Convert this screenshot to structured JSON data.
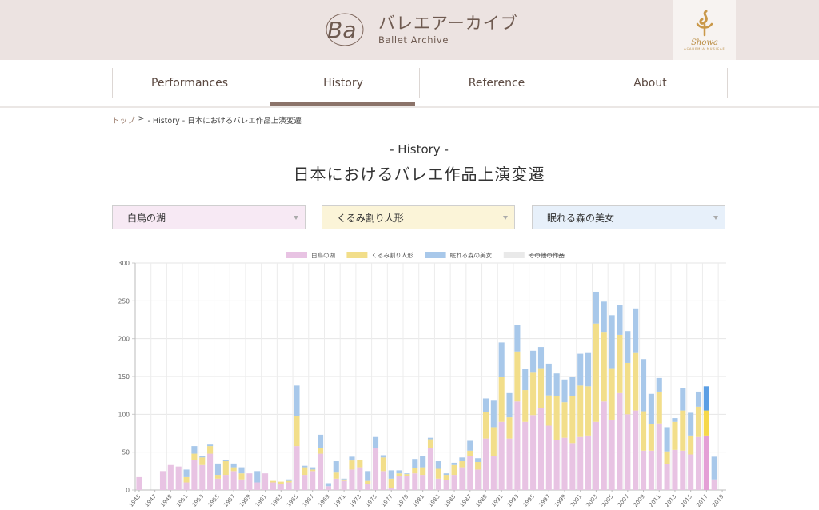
{
  "header": {
    "logo_monogram": "Ba",
    "logo_title_jp": "バレエアーカイブ",
    "logo_title_en": "Ballet Archive",
    "sponsor_name": "Showa",
    "sponsor_sub": "ACADEMIA MUSICAE"
  },
  "nav": {
    "items": [
      {
        "label": "Performances",
        "active": false
      },
      {
        "label": "History",
        "active": true
      },
      {
        "label": "Reference",
        "active": false
      },
      {
        "label": "About",
        "active": false
      }
    ]
  },
  "breadcrumb": {
    "home": "トップ",
    "separator": ">",
    "current": " - History - 日本におけるバレエ作品上演変遷"
  },
  "page": {
    "subtitle": "- History -",
    "title": "日本におけるバレエ作品上演変遷"
  },
  "selects": [
    {
      "value": "白鳥の湖",
      "color": "#f7e9f4"
    },
    {
      "value": "くるみ割り人形",
      "color": "#fbf4d8"
    },
    {
      "value": "眠れる森の美女",
      "color": "#e7f0fa"
    }
  ],
  "chart_data": {
    "type": "bar",
    "stacked": true,
    "title": "",
    "xlabel": "",
    "ylabel": "",
    "ylim": [
      0,
      300
    ],
    "yticks": [
      0,
      50,
      100,
      150,
      200,
      250,
      300
    ],
    "grid": true,
    "legend_position": "top",
    "categories": [
      "1945",
      "1946",
      "1947",
      "1948",
      "1949",
      "1950",
      "1951",
      "1952",
      "1953",
      "1954",
      "1955",
      "1956",
      "1957",
      "1958",
      "1959",
      "1960",
      "1961",
      "1962",
      "1963",
      "1964",
      "1965",
      "1966",
      "1967",
      "1968",
      "1969",
      "1970",
      "1971",
      "1972",
      "1973",
      "1974",
      "1975",
      "1976",
      "1977",
      "1978",
      "1979",
      "1980",
      "1981",
      "1982",
      "1983",
      "1984",
      "1985",
      "1986",
      "1987",
      "1988",
      "1989",
      "1990",
      "1991",
      "1992",
      "1993",
      "1994",
      "1995",
      "1996",
      "1997",
      "1998",
      "1999",
      "2000",
      "2001",
      "2002",
      "2003",
      "2004",
      "2005",
      "2006",
      "2007",
      "2008",
      "2009",
      "2010",
      "2011",
      "2012",
      "2013",
      "2014",
      "2015",
      "2016",
      "2017",
      "2018",
      "2019"
    ],
    "xtick_labels": [
      "1945",
      "1947",
      "1949",
      "1951",
      "1953",
      "1955",
      "1957",
      "1959",
      "1961",
      "1963",
      "1965",
      "1967",
      "1969",
      "1971",
      "1973",
      "1975",
      "1977",
      "1979",
      "1981",
      "1983",
      "1985",
      "1987",
      "1989",
      "1991",
      "1993",
      "1995",
      "1997",
      "1999",
      "2001",
      "2003",
      "2005",
      "2007",
      "2009",
      "2011",
      "2013",
      "2015",
      "2017",
      "2019"
    ],
    "highlighted_category": "2017",
    "series": [
      {
        "name": "白鳥の湖",
        "color": "#e8c3e3",
        "highlight_color": "#e49fd6",
        "values": [
          17,
          0,
          0,
          25,
          33,
          31,
          10,
          40,
          33,
          48,
          15,
          20,
          25,
          14,
          22,
          10,
          22,
          10,
          8,
          10,
          58,
          20,
          25,
          48,
          5,
          15,
          12,
          27,
          30,
          8,
          55,
          25,
          3,
          18,
          18,
          22,
          20,
          55,
          15,
          13,
          20,
          30,
          45,
          27,
          68,
          45,
          90,
          68,
          117,
          90,
          99,
          108,
          85,
          66,
          69,
          62,
          70,
          72,
          90,
          117,
          93,
          128,
          100,
          105,
          52,
          52,
          88,
          34,
          53,
          52,
          47,
          70,
          72,
          14
        ]
      },
      {
        "name": "くるみ割り人形",
        "color": "#f2de8a",
        "highlight_color": "#f6d84a",
        "values": [
          0,
          0,
          0,
          0,
          0,
          0,
          7,
          8,
          10,
          10,
          5,
          18,
          5,
          8,
          0,
          0,
          0,
          2,
          3,
          2,
          40,
          10,
          2,
          7,
          0,
          8,
          2,
          12,
          10,
          4,
          0,
          18,
          12,
          4,
          3,
          7,
          10,
          12,
          13,
          7,
          13,
          8,
          7,
          10,
          35,
          38,
          60,
          28,
          66,
          42,
          57,
          53,
          40,
          58,
          47,
          62,
          68,
          65,
          130,
          92,
          68,
          77,
          68,
          77,
          52,
          35,
          42,
          17,
          37,
          53,
          25,
          40,
          33,
          0
        ]
      },
      {
        "name": "眠れる森の美女",
        "color": "#a8c8ea",
        "highlight_color": "#5b9ee4",
        "values": [
          0,
          0,
          0,
          0,
          0,
          0,
          10,
          10,
          2,
          2,
          15,
          2,
          5,
          8,
          0,
          15,
          0,
          0,
          0,
          2,
          40,
          2,
          3,
          18,
          4,
          15,
          1,
          5,
          0,
          13,
          15,
          3,
          11,
          4,
          1,
          12,
          15,
          2,
          10,
          2,
          3,
          5,
          13,
          5,
          18,
          35,
          45,
          32,
          35,
          28,
          28,
          28,
          42,
          30,
          30,
          26,
          42,
          45,
          42,
          40,
          70,
          39,
          42,
          58,
          69,
          40,
          18,
          32,
          5,
          30,
          30,
          20,
          32,
          30,
          0
        ]
      },
      {
        "name": "その他の作品",
        "color": "#e9e9e9",
        "hidden": true,
        "values": []
      }
    ]
  }
}
